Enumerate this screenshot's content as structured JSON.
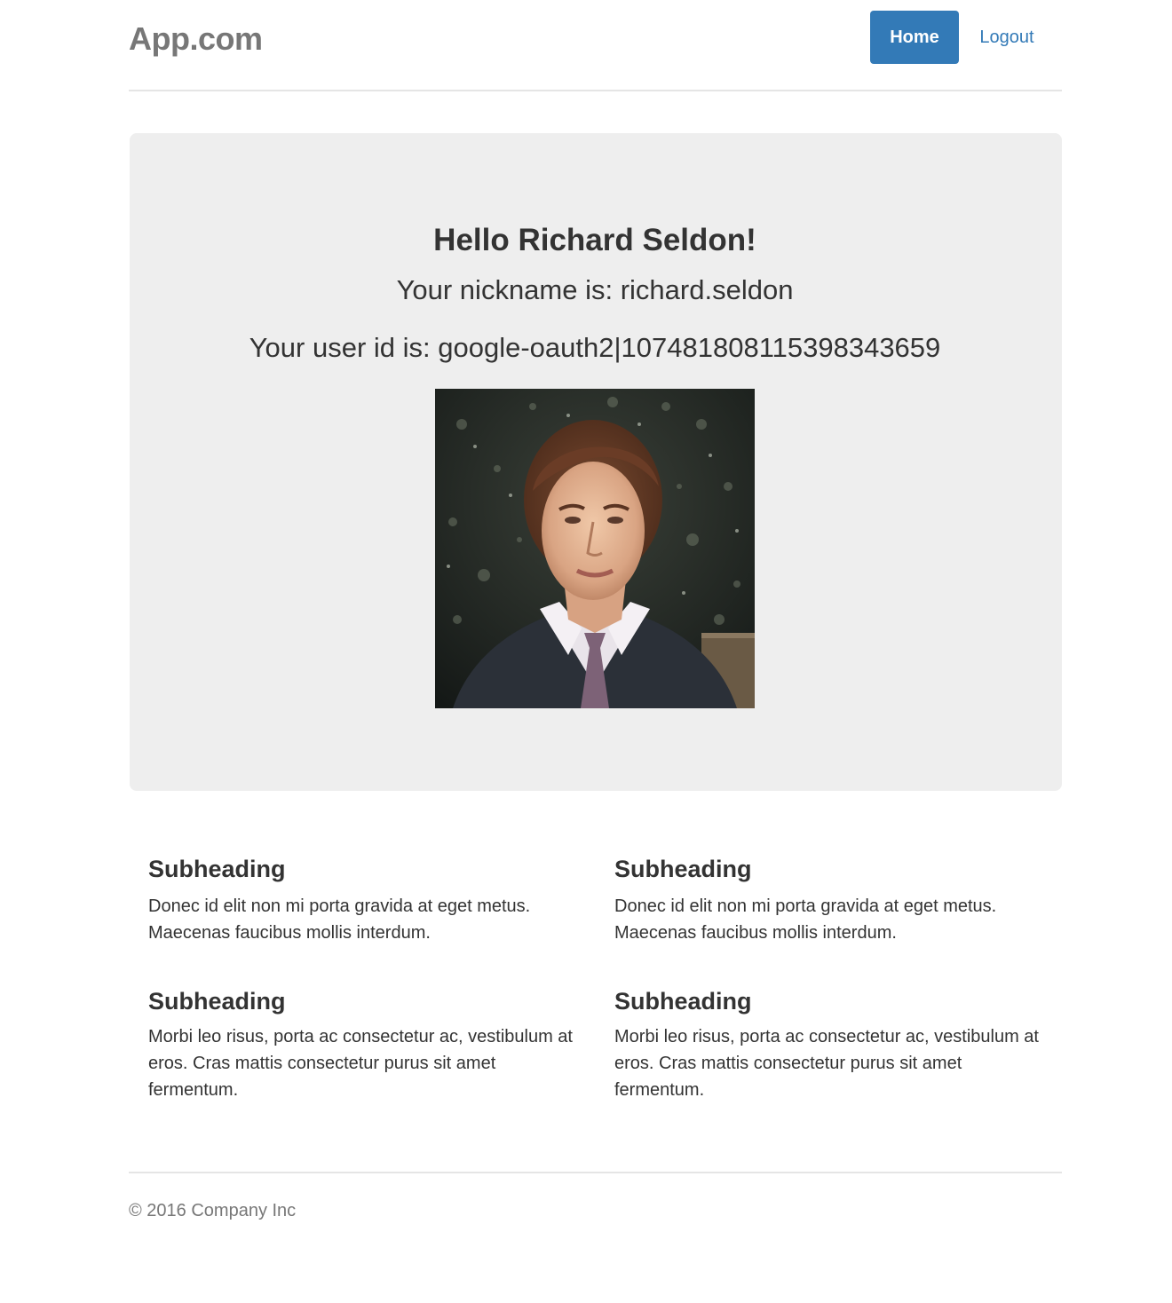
{
  "header": {
    "brand": "App.com",
    "nav": {
      "home_label": "Home",
      "logout_label": "Logout"
    }
  },
  "jumbotron": {
    "greeting": "Hello Richard Seldon!",
    "nickname_line": "Your nickname is: richard.seldon",
    "user_id_line": "Your user id is: google-oauth2|107481808115398343659",
    "avatar_icon": "profile-photo"
  },
  "marketing": {
    "columns": [
      {
        "items": [
          {
            "heading": "Subheading",
            "text": "Donec id elit non mi porta gravida at eget metus. Maecenas faucibus mollis interdum."
          },
          {
            "heading": "Subheading",
            "text": "Morbi leo risus, porta ac consectetur ac, vestibulum at eros. Cras mattis consectetur purus sit amet fermentum."
          }
        ]
      },
      {
        "items": [
          {
            "heading": "Subheading",
            "text": "Donec id elit non mi porta gravida at eget metus. Maecenas faucibus mollis interdum."
          },
          {
            "heading": "Subheading",
            "text": "Morbi leo risus, porta ac consectetur ac, vestibulum at eros. Cras mattis consectetur purus sit amet fermentum."
          }
        ]
      }
    ]
  },
  "footer": {
    "copyright": "© 2016 Company Inc"
  },
  "colors": {
    "primary": "#337ab7",
    "jumbotron_bg": "#eeeeee",
    "muted": "#777777"
  }
}
